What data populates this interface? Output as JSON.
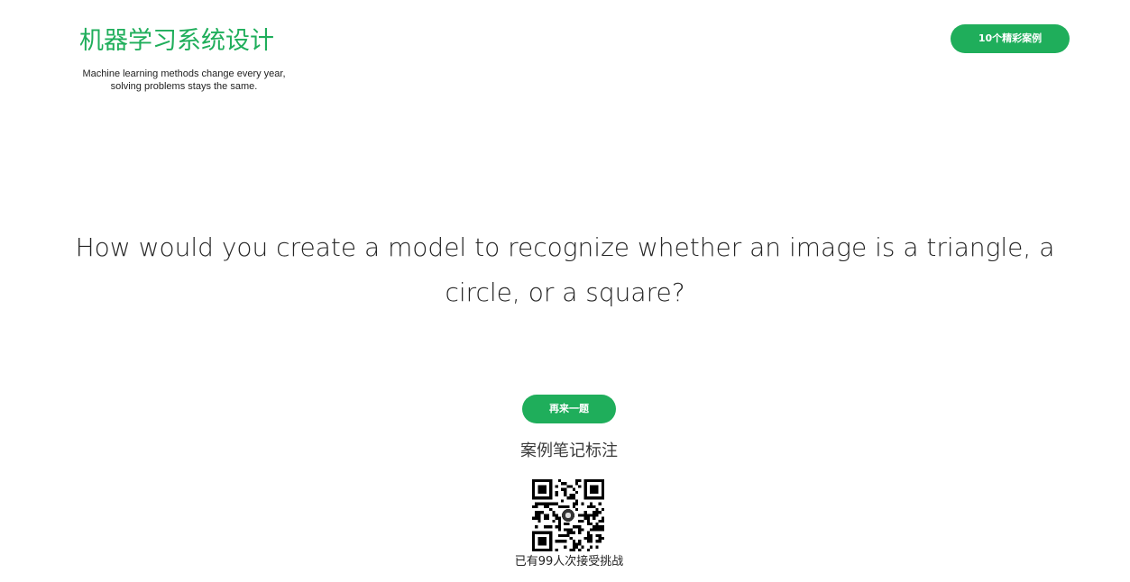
{
  "header": {
    "site_title": "机器学习系统设计",
    "tagline_line1": "Machine learning methods change every year,",
    "tagline_line2": "solving problems stays the same.",
    "cases_button_label": "10个精彩案例"
  },
  "main": {
    "question": "How would you create a model to recognize whether an image is a triangle, a circle, or a square?",
    "next_button_label": "再来一题",
    "notes_heading": "案例笔记标注",
    "qr_icon": "qr-code-icon",
    "challenge_count_text": "已有99人次接受挑战"
  },
  "colors": {
    "accent": "#1fae5b",
    "text": "#222222",
    "background": "#ffffff"
  }
}
